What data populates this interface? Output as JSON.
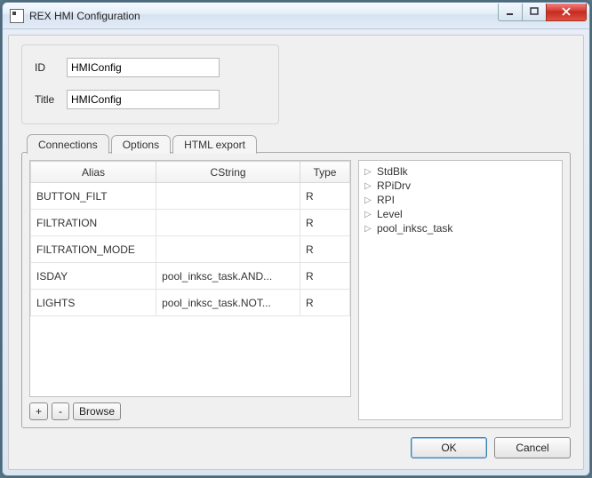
{
  "window": {
    "title": "REX HMI Configuration"
  },
  "form": {
    "id_label": "ID",
    "id_value": "HMIConfig",
    "title_label": "Title",
    "title_value": "HMIConfig"
  },
  "tabs": {
    "connections": "Connections",
    "options": "Options",
    "html_export": "HTML export"
  },
  "table": {
    "headers": {
      "alias": "Alias",
      "cstring": "CString",
      "type": "Type"
    },
    "rows": [
      {
        "alias": "BUTTON_FILT",
        "cstring": "",
        "type": "R"
      },
      {
        "alias": "FILTRATION",
        "cstring": "",
        "type": "R"
      },
      {
        "alias": "FILTRATION_MODE",
        "cstring": "",
        "type": "R"
      },
      {
        "alias": "ISDAY",
        "cstring": "pool_inksc_task.AND...",
        "type": "R"
      },
      {
        "alias": "LIGHTS",
        "cstring": "pool_inksc_task.NOT...",
        "type": "R"
      }
    ]
  },
  "tools": {
    "add": "+",
    "remove": "-",
    "browse": "Browse"
  },
  "tree": {
    "items": [
      "StdBlk",
      "RPiDrv",
      "RPI",
      "Level",
      "pool_inksc_task"
    ]
  },
  "buttons": {
    "ok": "OK",
    "cancel": "Cancel"
  }
}
